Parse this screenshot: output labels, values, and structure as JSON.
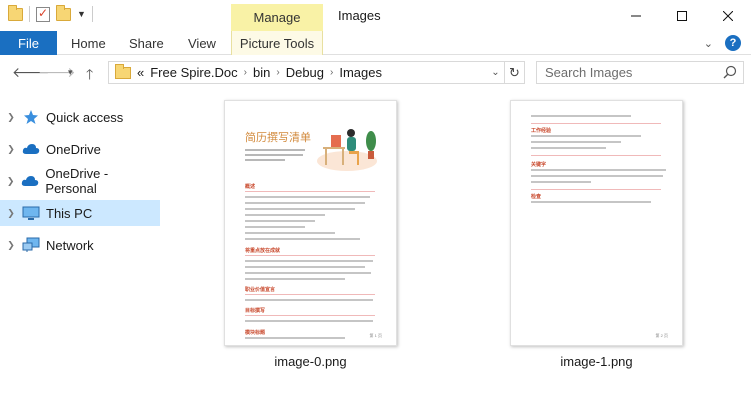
{
  "window": {
    "title": "Images",
    "contextual_tab_group": "Manage",
    "controls": {
      "minimize": "—",
      "maximize": "☐",
      "close": "✕"
    }
  },
  "ribbon": {
    "file_tab": "File",
    "tabs": [
      "Home",
      "Share",
      "View"
    ],
    "contextual_tab": "Picture Tools"
  },
  "address": {
    "overflow": "«",
    "crumbs": [
      "Free Spire.Doc",
      "bin",
      "Debug",
      "Images"
    ]
  },
  "search": {
    "placeholder": "Search Images"
  },
  "nav": {
    "items": [
      {
        "label": "Quick access",
        "icon": "star-icon"
      },
      {
        "label": "OneDrive",
        "icon": "cloud-icon"
      },
      {
        "label": "OneDrive - Personal",
        "icon": "cloud-icon"
      },
      {
        "label": "This PC",
        "icon": "monitor-icon",
        "selected": true
      },
      {
        "label": "Network",
        "icon": "network-icon"
      }
    ]
  },
  "files": [
    {
      "name": "image-0.png",
      "doc_title": "简历撰写清单",
      "page": "第 1 页"
    },
    {
      "name": "image-1.png",
      "page": "第 2 页"
    }
  ],
  "colors": {
    "accent": "#1a6fc1",
    "selection": "#cce8ff",
    "manage_tab": "#f9f2a6"
  }
}
